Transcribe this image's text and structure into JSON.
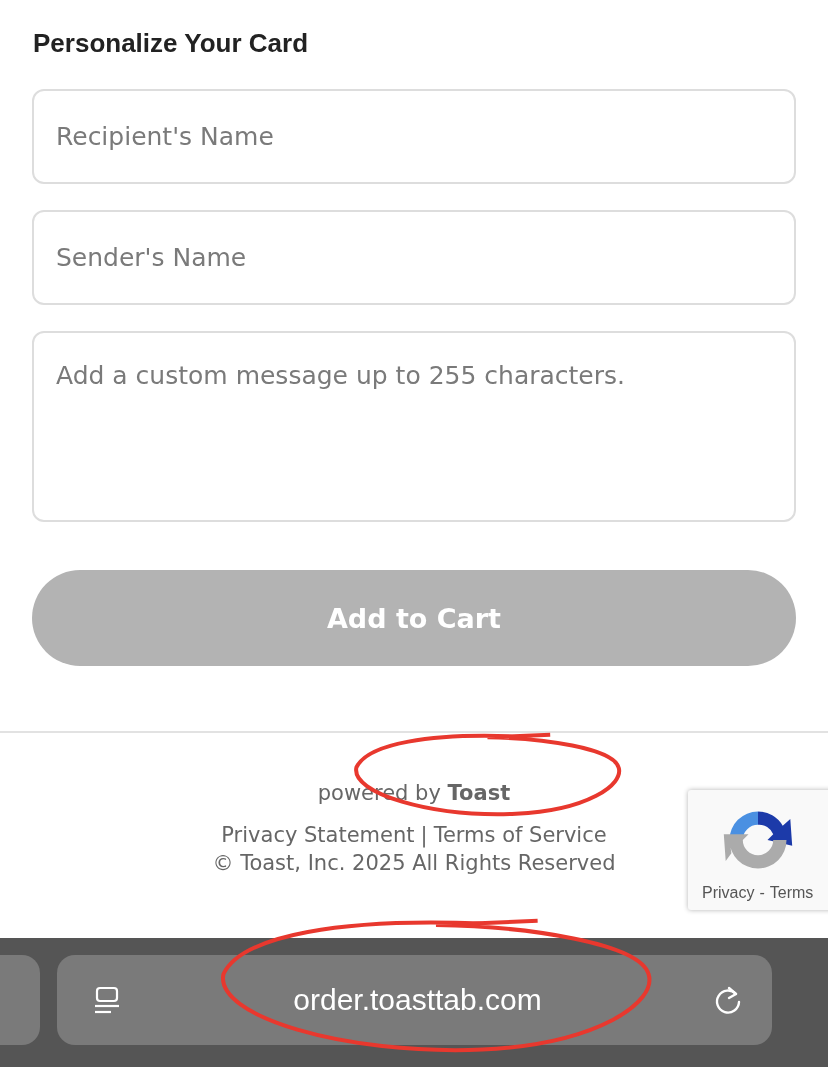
{
  "section_title": "Personalize Your Card",
  "fields": [
    {
      "kind": "input",
      "placeholder": "Recipient's Name"
    },
    {
      "kind": "input",
      "placeholder": "Sender's Name"
    },
    {
      "kind": "textarea",
      "placeholder": "Add a custom message up to 255 characters."
    }
  ],
  "add_button": {
    "label": "Add to Cart",
    "disabled": true
  },
  "footer": {
    "powered_by": "powered by **Toast**",
    "links": [
      "Privacy Statement",
      "Terms of Service"
    ],
    "separator": "|",
    "copyright": "© Toast, Inc. 2025 All Rights Reserved"
  },
  "recaptcha": {
    "links": [
      "Privacy",
      "Terms"
    ],
    "separator": "-"
  },
  "browser_bar": {
    "url": "order.toasttab.com"
  },
  "annotations": [
    {
      "kind": "circle"
    },
    {
      "kind": "circle"
    }
  ]
}
